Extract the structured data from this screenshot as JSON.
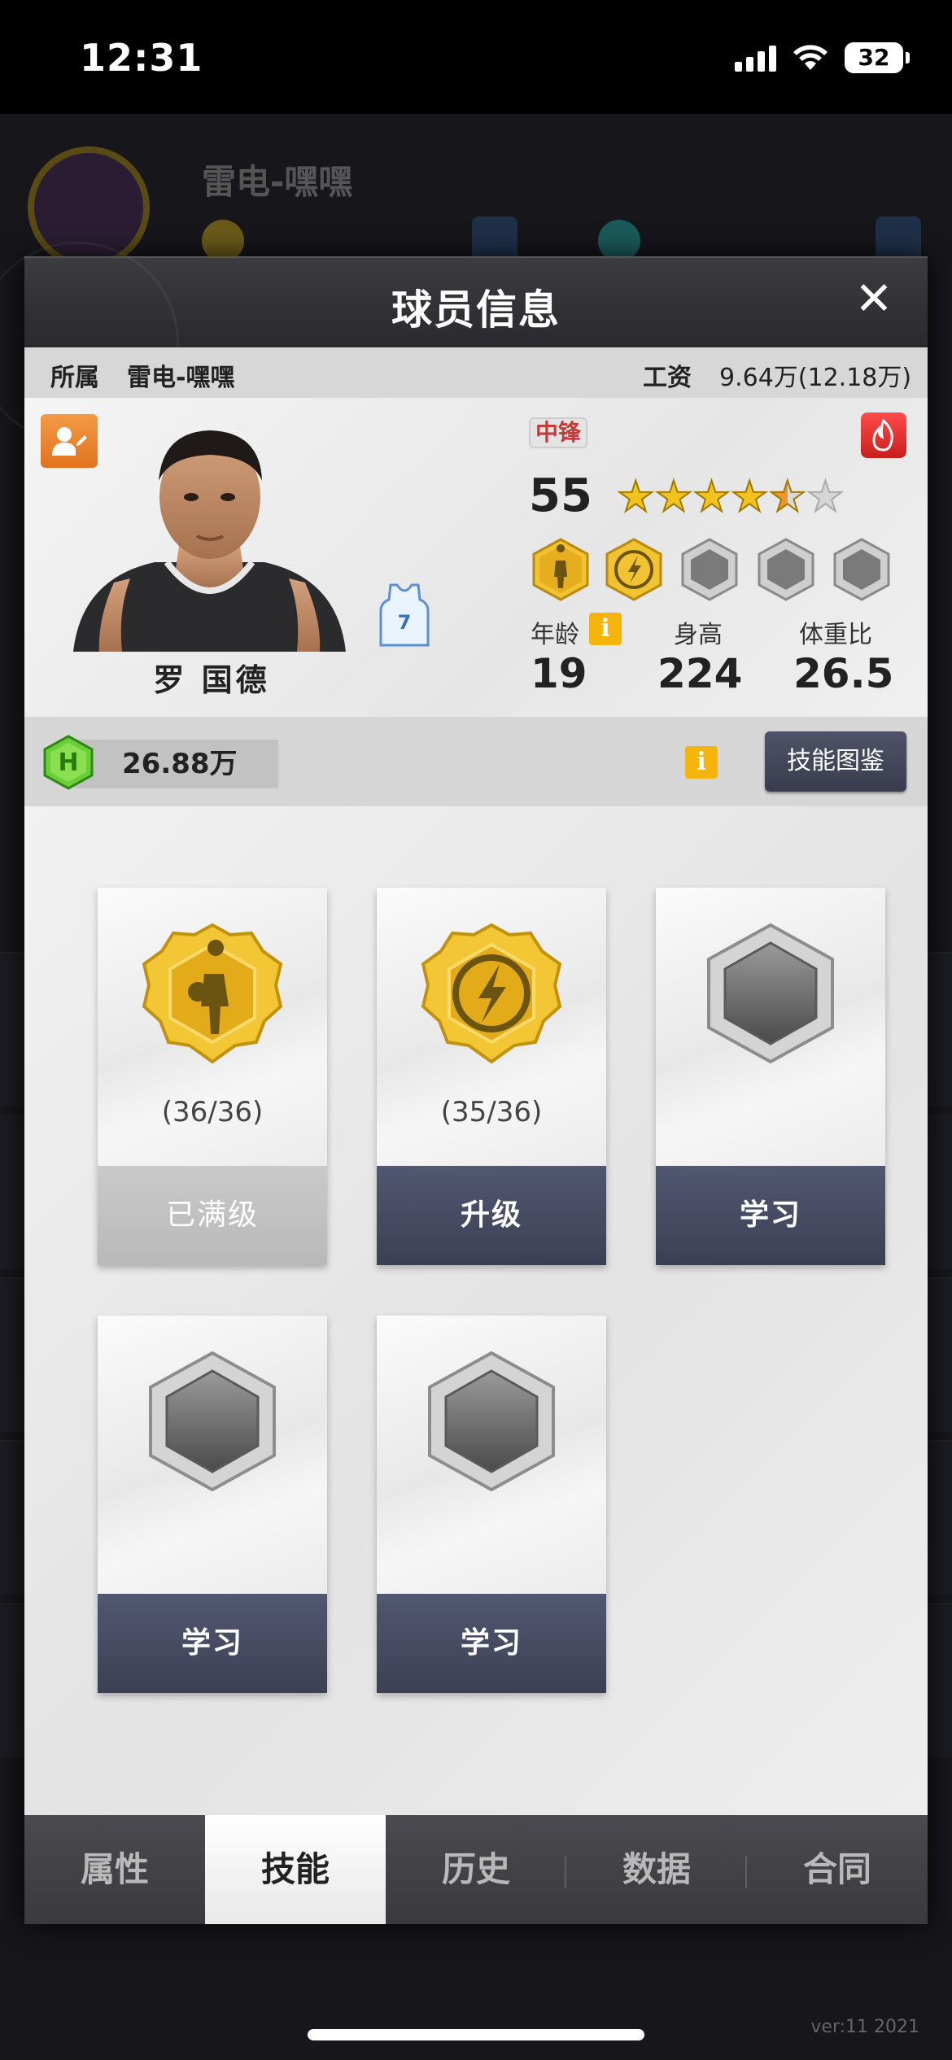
{
  "status_bar": {
    "time": "12:31",
    "battery": "32"
  },
  "background": {
    "title": "雷电-嘿嘿",
    "version": "ver:11  2021"
  },
  "modal": {
    "title": "球员信息",
    "team_label": "所属",
    "team_value": "雷电-嘿嘿",
    "salary_label": "工资",
    "salary_value": "9.64万(12.18万)"
  },
  "player": {
    "name": "罗 国德",
    "jersey_number": "7",
    "position": "中锋",
    "rating": "55",
    "stars": 4.5,
    "age_label": "年龄",
    "age": "19",
    "height_label": "身高",
    "height": "224",
    "ratio_label": "体重比",
    "ratio": "26.5"
  },
  "coins": {
    "amount": "26.88万",
    "skill_book_button": "技能图鉴"
  },
  "skills": [
    {
      "icon": "silhouette-skill-icon",
      "progress": "(36/36)",
      "button": "已满级",
      "state": "maxed"
    },
    {
      "icon": "lightning-skill-icon",
      "progress": "(35/36)",
      "button": "升级",
      "state": "upgrade"
    },
    {
      "icon": "empty-skill-slot-icon",
      "progress": "",
      "button": "学习",
      "state": "learn"
    },
    {
      "icon": "empty-skill-slot-icon",
      "progress": "",
      "button": "学习",
      "state": "learn"
    },
    {
      "icon": "empty-skill-slot-icon",
      "progress": "",
      "button": "学习",
      "state": "learn"
    }
  ],
  "tabs": [
    {
      "label": "属性",
      "active": false
    },
    {
      "label": "技能",
      "active": true
    },
    {
      "label": "历史",
      "active": false
    },
    {
      "label": "数据",
      "active": false
    },
    {
      "label": "合同",
      "active": false
    }
  ],
  "colors": {
    "gold": "#f2c21f",
    "button_dark": "#474b60",
    "accent_orange": "#f0952a",
    "position_red": "#c23a3a"
  }
}
